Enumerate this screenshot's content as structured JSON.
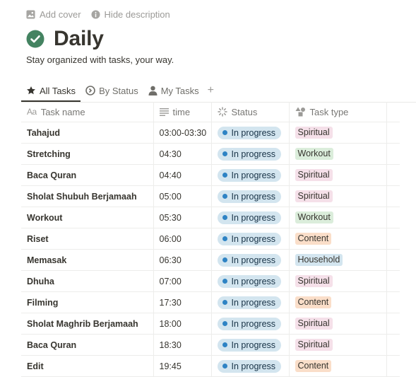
{
  "page": {
    "actions": {
      "add_cover": "Add cover",
      "hide_description": "Hide description"
    },
    "title": "Daily",
    "description": "Stay organized with tasks, your way."
  },
  "tabs": [
    {
      "label": "All Tasks",
      "icon": "star-icon"
    },
    {
      "label": "By Status",
      "icon": "status-circle-icon"
    },
    {
      "label": "My Tasks",
      "icon": "person-icon"
    }
  ],
  "columns": {
    "name": "Task name",
    "time": "time",
    "status": "Status",
    "type": "Task type"
  },
  "colors": {
    "status_in_progress_bg": "#d3e5ef",
    "status_dot": "#2e83c4",
    "Spiritual": "#f5e0e9",
    "Workout": "#dbeddb",
    "Content": "#fadec9",
    "Household": "#d3e5ef",
    "check_circle": "#448361"
  },
  "rows": [
    {
      "name": "Tahajud",
      "time": "03:00-03:30",
      "status": "In progress",
      "type": "Spiritual"
    },
    {
      "name": "Stretching",
      "time": "04:30",
      "status": "In progress",
      "type": "Workout"
    },
    {
      "name": "Baca Quran",
      "time": "04:40",
      "status": "In progress",
      "type": "Spiritual"
    },
    {
      "name": "Sholat Shubuh Berjamaah",
      "time": "05:00",
      "status": "In progress",
      "type": "Spiritual"
    },
    {
      "name": "Workout",
      "time": "05:30",
      "status": "In progress",
      "type": "Workout"
    },
    {
      "name": "Riset",
      "time": "06:00",
      "status": "In progress",
      "type": "Content"
    },
    {
      "name": "Memasak",
      "time": "06:30",
      "status": "In progress",
      "type": "Household"
    },
    {
      "name": "Dhuha",
      "time": "07:00",
      "status": "In progress",
      "type": "Spiritual"
    },
    {
      "name": "Filming",
      "time": "17:30",
      "status": "In progress",
      "type": "Content"
    },
    {
      "name": "Sholat Maghrib Berjamaah",
      "time": "18:00",
      "status": "In progress",
      "type": "Spiritual"
    },
    {
      "name": "Baca Quran",
      "time": "18:30",
      "status": "In progress",
      "type": "Spiritual"
    },
    {
      "name": "Edit",
      "time": "19:45",
      "status": "In progress",
      "type": "Content"
    }
  ]
}
